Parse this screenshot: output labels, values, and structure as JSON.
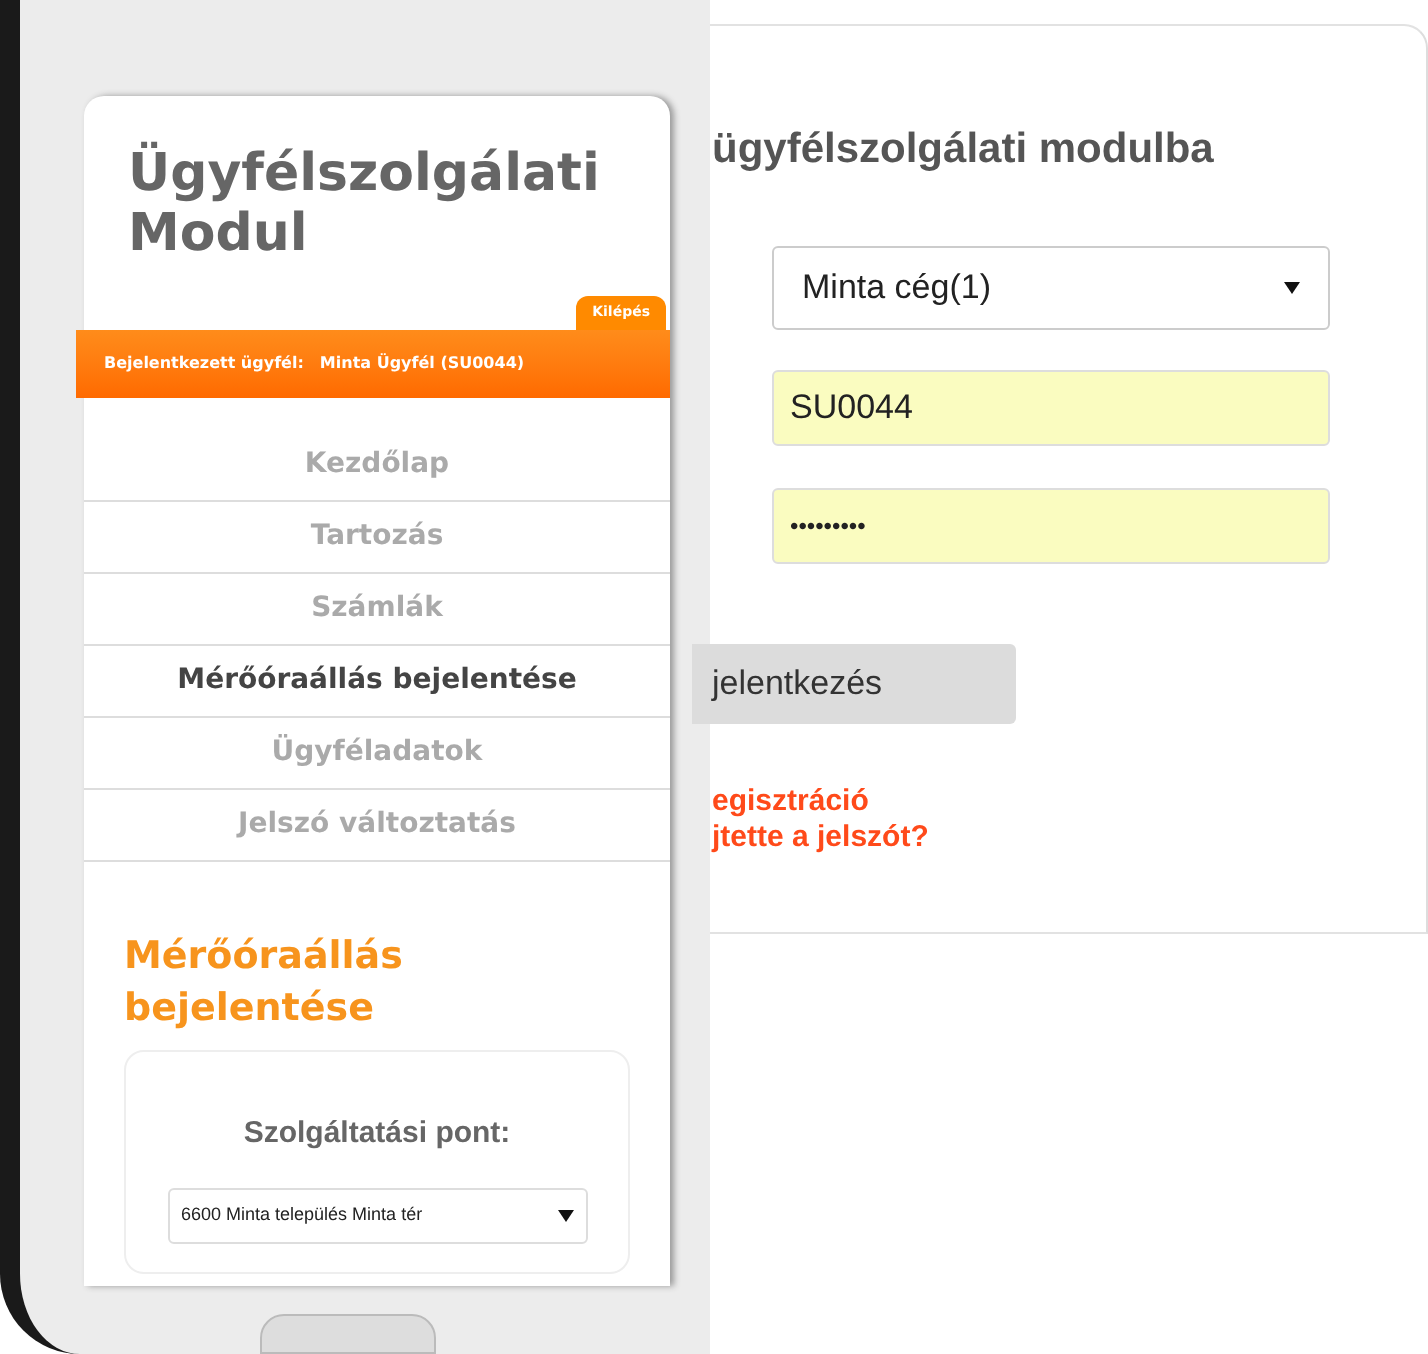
{
  "phone": {
    "title": "Ügyfélszolgálati Modul",
    "logout": "Kilépés",
    "user_bar": {
      "label": "Bejelentkezett ügyfél:",
      "value": "Minta Ügyfél (SU0044)"
    },
    "nav": [
      {
        "label": "Kezdőlap",
        "selected": false
      },
      {
        "label": "Tartozás",
        "selected": false
      },
      {
        "label": "Számlák",
        "selected": false
      },
      {
        "label": "Mérőóraállás bejelentése",
        "selected": true
      },
      {
        "label": "Ügyféladatok",
        "selected": false
      },
      {
        "label": "Jelszó változtatás",
        "selected": false
      }
    ],
    "section_title": "Mérőóraállás bejelentése",
    "service_point": {
      "label": "Szolgáltatási pont:",
      "value": "6600 Minta település Minta tér"
    }
  },
  "login": {
    "title": "ügyfélszolgálati modulba",
    "company": {
      "value": "Minta cég(1)"
    },
    "username": {
      "value": "SU0044"
    },
    "password": {
      "value": "•••••••••"
    },
    "button": "jelentkezés",
    "links": [
      "egisztráció",
      "jtette a jelszót?"
    ]
  }
}
